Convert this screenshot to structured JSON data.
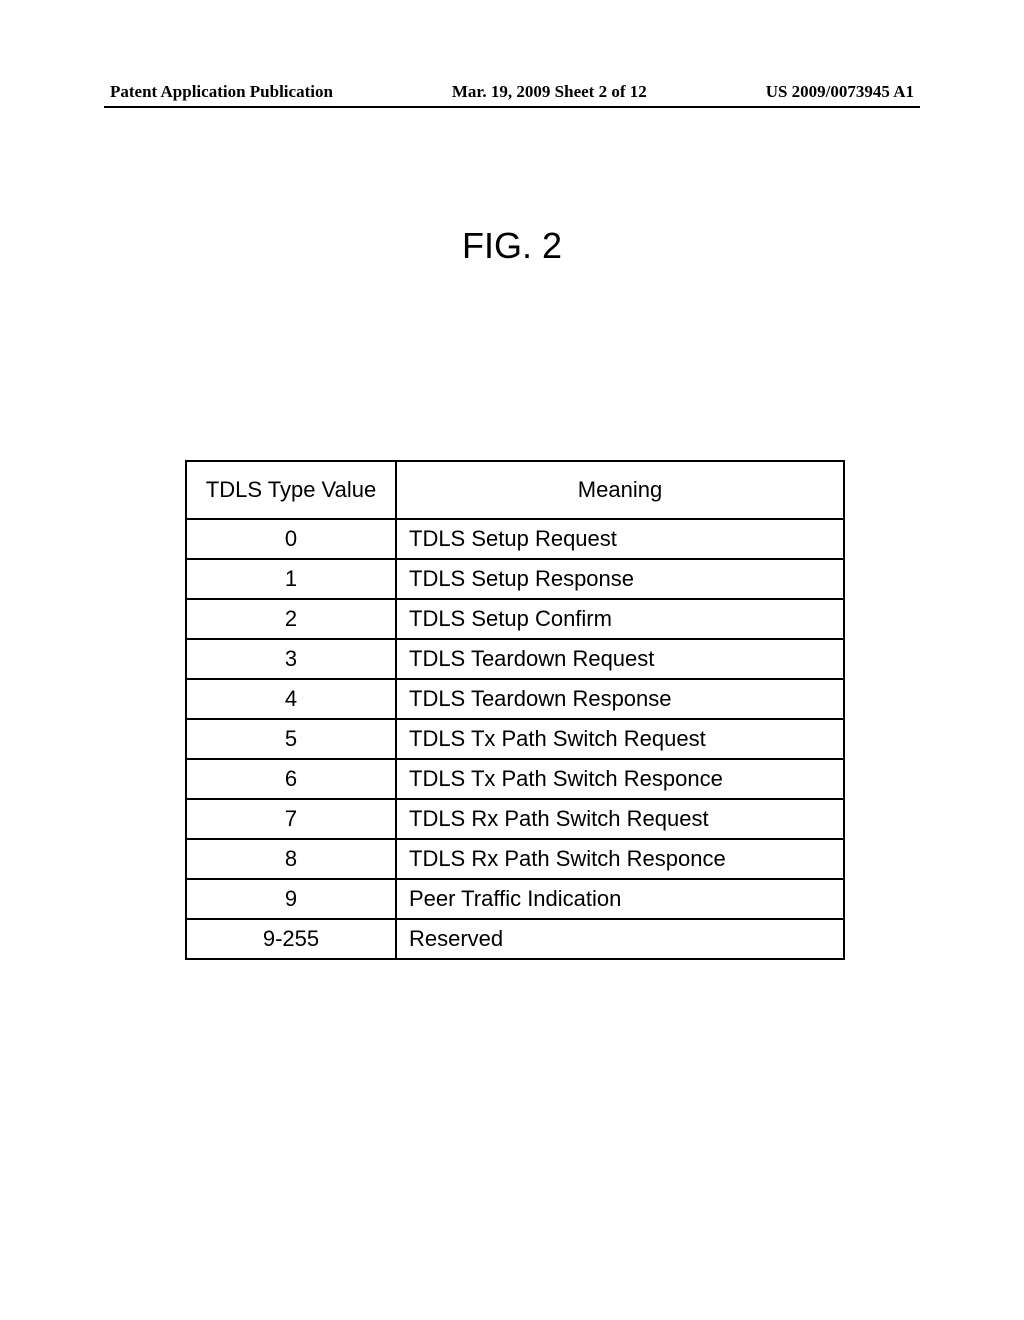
{
  "header": {
    "left": "Patent Application Publication",
    "center": "Mar. 19, 2009 Sheet 2 of 12",
    "right": "US 2009/0073945 A1"
  },
  "figure": {
    "title": "FIG. 2"
  },
  "table": {
    "headers": {
      "col1": "TDLS Type Value",
      "col2": "Meaning"
    },
    "rows": [
      {
        "value": "0",
        "meaning": "TDLS Setup Request"
      },
      {
        "value": "1",
        "meaning": "TDLS Setup Response"
      },
      {
        "value": "2",
        "meaning": "TDLS Setup Confirm"
      },
      {
        "value": "3",
        "meaning": "TDLS Teardown Request"
      },
      {
        "value": "4",
        "meaning": "TDLS Teardown Response"
      },
      {
        "value": "5",
        "meaning": "TDLS Tx Path Switch Request"
      },
      {
        "value": "6",
        "meaning": "TDLS Tx Path Switch Responce"
      },
      {
        "value": "7",
        "meaning": "TDLS Rx Path Switch Request"
      },
      {
        "value": "8",
        "meaning": "TDLS Rx Path Switch Responce"
      },
      {
        "value": "9",
        "meaning": "Peer Traffic Indication"
      },
      {
        "value": "9-255",
        "meaning": "Reserved"
      }
    ]
  }
}
